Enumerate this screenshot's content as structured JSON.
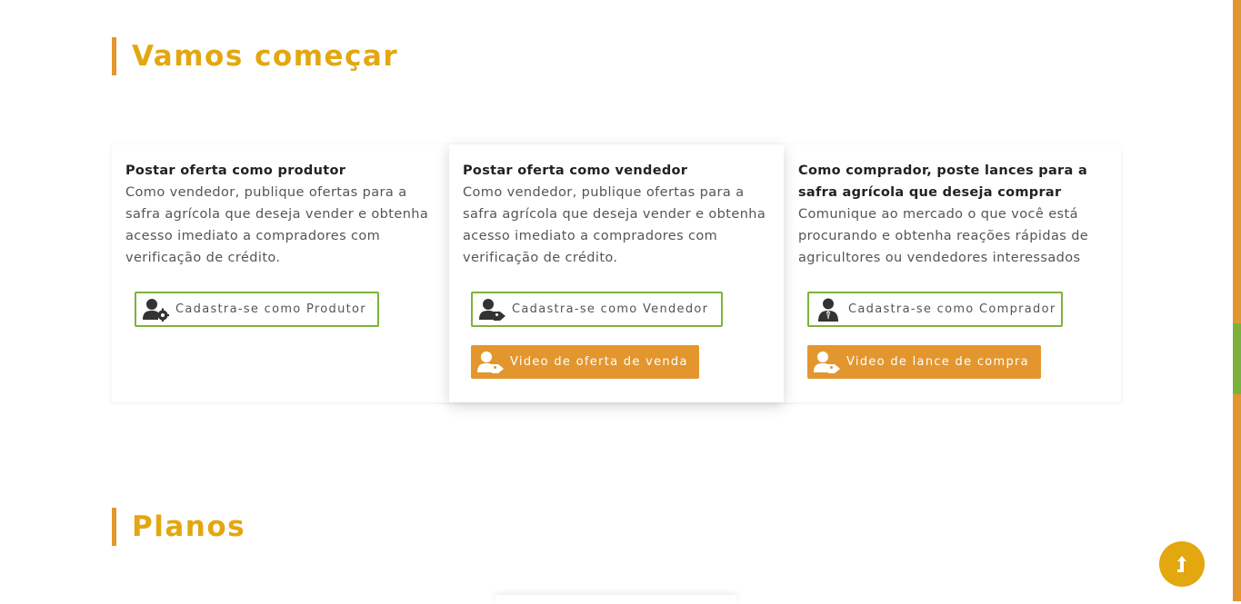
{
  "sections": {
    "start_title": "Vamos começar",
    "plans_title": "Planos"
  },
  "cards": [
    {
      "title": "Postar oferta como produtor",
      "text": "Como vendedor, publique ofertas para a safra agrícola que deseja vender e obtenha acesso imediato a compradores com verificação de crédito.",
      "register_label": "Cadastra-se como Produtor",
      "register_icon": "user-gear-icon"
    },
    {
      "title": "Postar oferta como vendedor",
      "text": "Como vendedor, publique ofertas para a safra agrícola que deseja vender e obtenha acesso imediato a compradores com verificação de crédito.",
      "register_label": "Cadastra-se como Vendedor",
      "register_icon": "user-tag-icon",
      "video_label": "Video de oferta de venda",
      "video_icon": "user-tag-icon"
    },
    {
      "title": "Como comprador, poste lances para a safra agrícola que deseja comprar",
      "text": "Comunique ao mercado o que você está procurando e obtenha reações rápidas de agricultores ou vendedores interessados",
      "register_label": "Cadastra-se como Comprador",
      "register_icon": "user-tie-icon",
      "video_label": "Video de lance de compra",
      "video_icon": "user-tag-icon"
    }
  ],
  "colors": {
    "accent": "#e3962e",
    "title": "#e3a70f",
    "outline": "#7cb23a"
  },
  "back_to_top_icon": "arrow-up-icon"
}
